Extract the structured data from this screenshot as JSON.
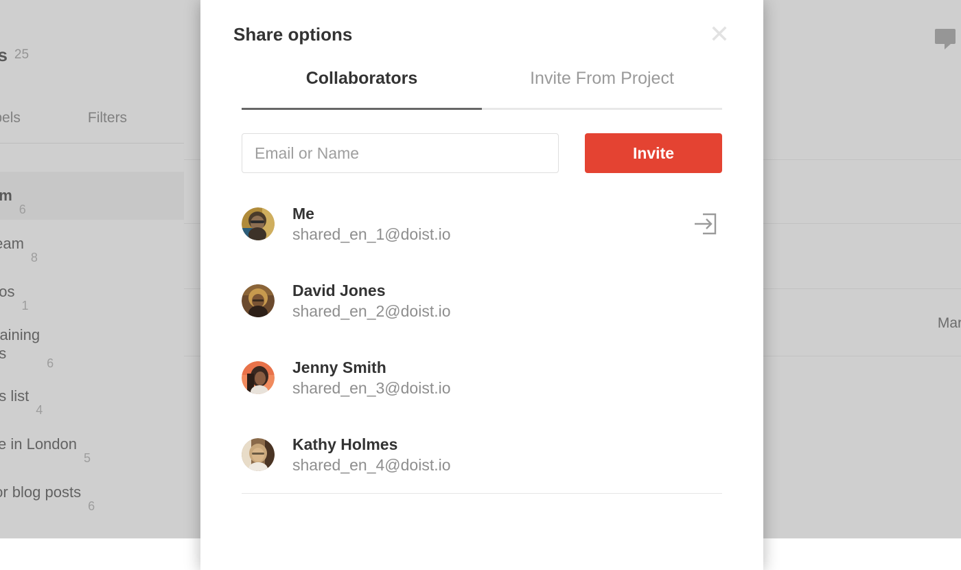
{
  "background": {
    "sidebar": {
      "header": {
        "title_partial": "ys",
        "count": "25"
      },
      "tabs": [
        {
          "label": "Labels"
        },
        {
          "label": "Filters"
        }
      ],
      "projects": [
        {
          "name_partial": "am",
          "count": "6",
          "selected": true,
          "two_line": false
        },
        {
          "name_partial": "team",
          "count": "8",
          "selected": false,
          "two_line": false
        },
        {
          "name_partial": "dos",
          "count": "1",
          "selected": false,
          "two_line": false
        },
        {
          "name_partial": "training\nns",
          "count": "6",
          "selected": false,
          "two_line": true
        },
        {
          "name_partial": "es list",
          "count": "4",
          "selected": false,
          "two_line": false
        },
        {
          "name_partial": "ce in London",
          "count": "5",
          "selected": false,
          "two_line": false
        },
        {
          "name_partial": "for blog posts",
          "count": "6",
          "selected": false,
          "two_line": false
        }
      ]
    },
    "content": {
      "date_label_partial": "Mar ",
      "comment_icon": "comment-bubble-icon"
    }
  },
  "modal": {
    "title": "Share options",
    "close_label": "✕",
    "close_icon": "close-icon",
    "tabs": [
      {
        "label": "Collaborators",
        "active": true
      },
      {
        "label": "Invite From Project",
        "active": false
      }
    ],
    "invite": {
      "placeholder": "Email or Name",
      "value": "",
      "button_label": "Invite"
    },
    "collaborators": [
      {
        "name": "Me",
        "email": "shared_en_1@doist.io",
        "avatar_colors": [
          "#b08b3a",
          "#4a3b2a",
          "#2c5d7a"
        ],
        "has_leave_action": true
      },
      {
        "name": "David Jones",
        "email": "shared_en_2@doist.io",
        "avatar_colors": [
          "#c79a4e",
          "#6b4a2e",
          "#3d2a1a"
        ],
        "has_leave_action": false
      },
      {
        "name": "Jenny Smith",
        "email": "shared_en_3@doist.io",
        "avatar_colors": [
          "#f08a5d",
          "#e8724a",
          "#3a2820"
        ],
        "has_leave_action": false
      },
      {
        "name": "Kathy Holmes",
        "email": "shared_en_4@doist.io",
        "avatar_colors": [
          "#c9a87c",
          "#8a6a4a",
          "#e8dcc8"
        ],
        "has_leave_action": false
      }
    ],
    "leave_icon": "leave-project-icon"
  },
  "colors": {
    "accent_red": "#e44332",
    "active_tab_underline": "#666666",
    "text_primary": "#333333",
    "text_secondary": "#8e8e8e"
  }
}
